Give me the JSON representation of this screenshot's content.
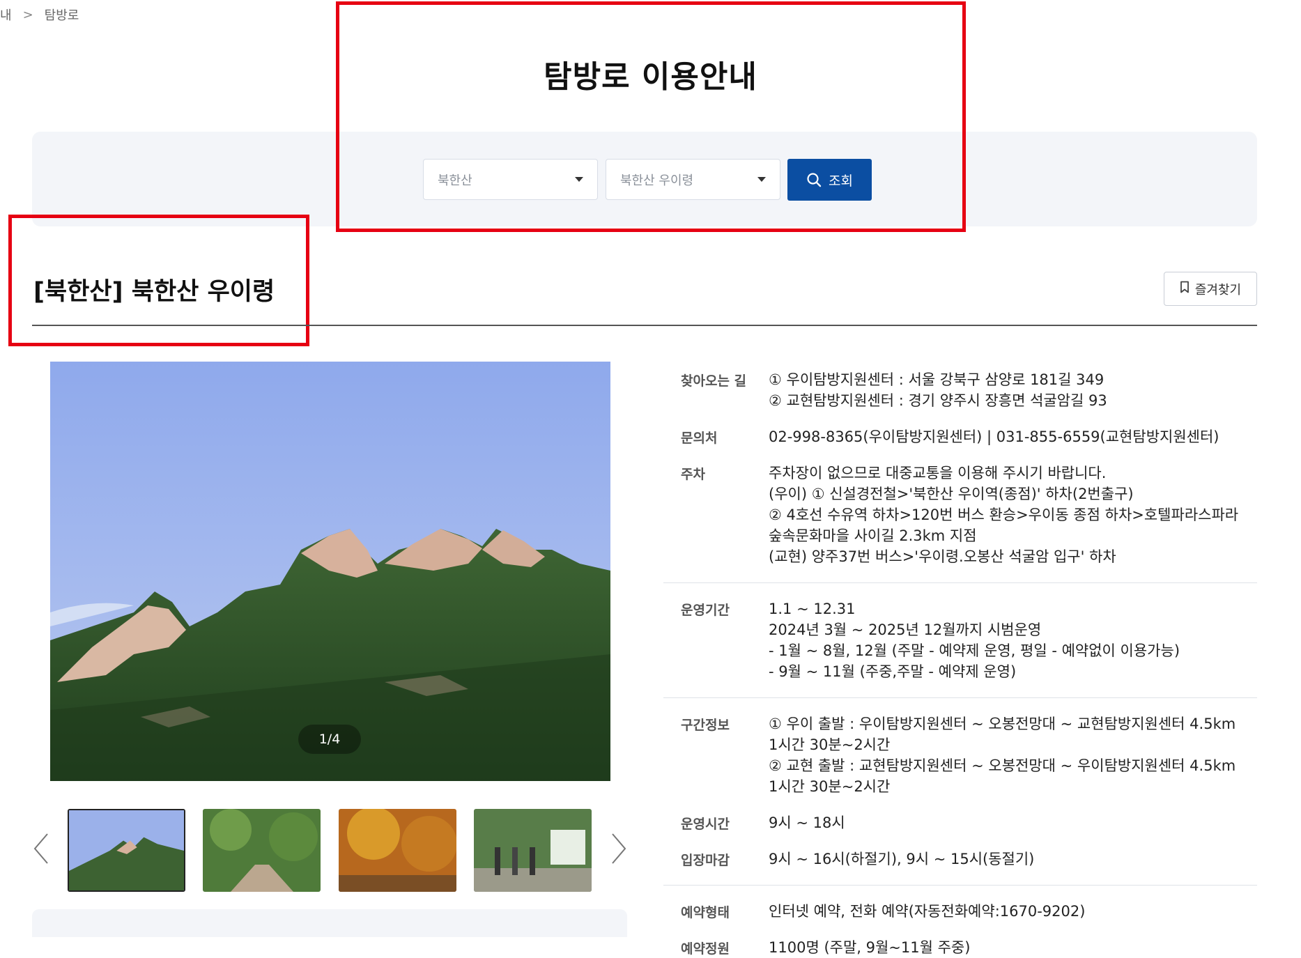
{
  "breadcrumb": {
    "prev": "내",
    "separator": ">",
    "current": "탐방로"
  },
  "header": {
    "title": "탐방로 이용안내"
  },
  "search": {
    "park_select": "북한산",
    "trail_select": "북한산 우이령",
    "button_label": "조회"
  },
  "trail": {
    "title": "[북한산] 북한산 우이령",
    "favorite_label": "즐겨찾기"
  },
  "gallery": {
    "counter": "1/4",
    "thumb_count": 4,
    "active_index": 0
  },
  "info": {
    "directions": {
      "label": "찾아오는 길",
      "lines": [
        "① 우이탐방지원센터 : 서울 강북구 삼양로 181길 349",
        "② 교현탐방지원센터 : 경기 양주시 장흥면 석굴암길 93"
      ]
    },
    "contact": {
      "label": "문의처",
      "lines": [
        "02-998-8365(우이탐방지원센터) | 031-855-6559(교현탐방지원센터)"
      ]
    },
    "parking": {
      "label": "주차",
      "lines": [
        "주차장이 없으므로 대중교통을 이용해 주시기 바랍니다.",
        "(우이) ① 신설경전철>'북한산 우이역(종점)' 하차(2번출구)",
        "② 4호선 수유역 하차>120번 버스 환승>우이동 종점 하차>호텔파라스파라",
        "숲속문화마을 사이길 2.3km 지점",
        "(교현) 양주37번 버스>'우이령.오봉산 석굴암 입구' 하차"
      ]
    },
    "period": {
      "label": "운영기간",
      "lines": [
        "1.1 ~ 12.31",
        "2024년 3월 ~ 2025년 12월까지 시범운영",
        "- 1월 ~ 8월, 12월 (주말 - 예약제 운영, 평일 - 예약없이 이용가능)",
        "- 9월 ~ 11월 (주중,주말 - 예약제 운영)"
      ]
    },
    "section": {
      "label": "구간정보",
      "lines": [
        "① 우이 출발 : 우이탐방지원센터 ~ 오봉전망대 ~ 교현탐방지원센터 4.5km",
        "1시간 30분~2시간",
        "② 교현 출발 : 교현탐방지원센터 ~ 오봉전망대 ~ 우이탐방지원센터 4.5km",
        "1시간 30분~2시간"
      ]
    },
    "hours": {
      "label": "운영시간",
      "lines": [
        "9시 ~ 18시"
      ]
    },
    "closing": {
      "label": "입장마감",
      "lines": [
        "9시 ~ 16시(하절기), 9시 ~ 15시(동절기)"
      ]
    },
    "reservation": {
      "label": "예약형태",
      "lines": [
        "인터넷 예약, 전화 예약(자동전화예약:1670-9202)"
      ]
    },
    "capacity": {
      "label": "예약정원",
      "lines": [
        "1100명 (주말, 9월~11월 주중)"
      ]
    }
  },
  "colors": {
    "accent": "#0b4ea2",
    "highlight_box": "#e60012",
    "panel_bg": "#f3f5f9"
  },
  "icons": {
    "search": "search-icon",
    "bookmark": "bookmark-icon",
    "prev": "chevron-left-icon",
    "next": "chevron-right-icon",
    "dropdown": "caret-down-icon"
  }
}
